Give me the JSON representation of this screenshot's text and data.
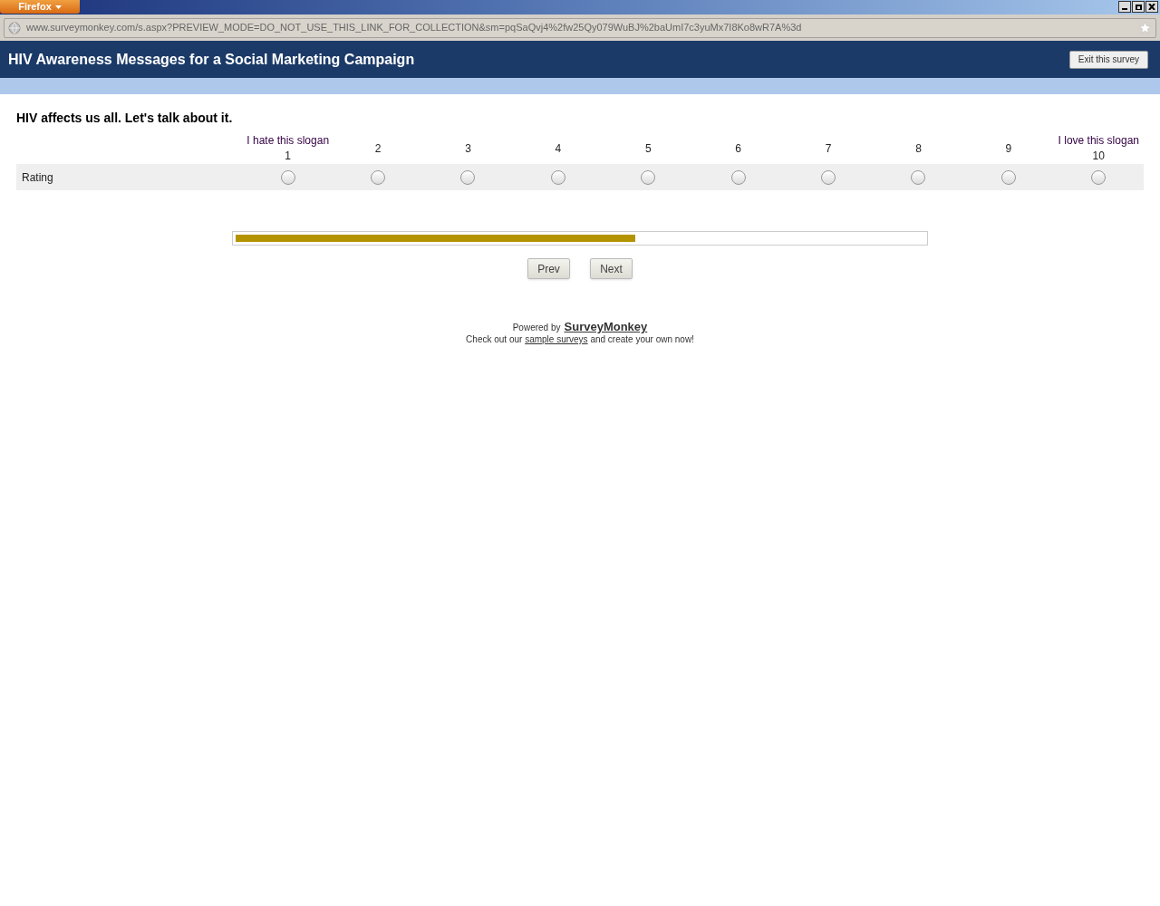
{
  "browser": {
    "menu_button": "Firefox",
    "url": "www.surveymonkey.com/s.aspx?PREVIEW_MODE=DO_NOT_USE_THIS_LINK_FOR_COLLECTION&sm=pqSaQvj4%2fw25Qy079WuBJ%2baUmI7c3yuMx7I8Ko8wR7A%3d"
  },
  "header": {
    "title": "HIV Awareness Messages for a Social Marketing Campaign",
    "exit_button": "Exit this survey"
  },
  "question": {
    "title": "HIV affects us all. Let's talk about it.",
    "columns": [
      {
        "label": "I hate this slogan",
        "number": "1"
      },
      {
        "number": "2"
      },
      {
        "number": "3"
      },
      {
        "number": "4"
      },
      {
        "number": "5"
      },
      {
        "number": "6"
      },
      {
        "number": "7"
      },
      {
        "number": "8"
      },
      {
        "number": "9"
      },
      {
        "label": "I love this slogan",
        "number": "10"
      }
    ],
    "rows": [
      {
        "label": "Rating",
        "options": [
          {
            "selected": false
          },
          {
            "selected": false
          },
          {
            "selected": false
          },
          {
            "selected": false
          },
          {
            "selected": false
          },
          {
            "selected": false
          },
          {
            "selected": false
          },
          {
            "selected": false
          },
          {
            "selected": false
          },
          {
            "selected": false
          }
        ]
      }
    ]
  },
  "progress": {
    "level": 0.58
  },
  "buttons": [
    "Prev",
    "Next"
  ],
  "footer": {
    "powered_by": "Powered by",
    "brand_link": "SurveyMonkey",
    "promo_before": "Check out our ",
    "promo_link": "sample surveys",
    "promo_after": " and create your own now!"
  }
}
